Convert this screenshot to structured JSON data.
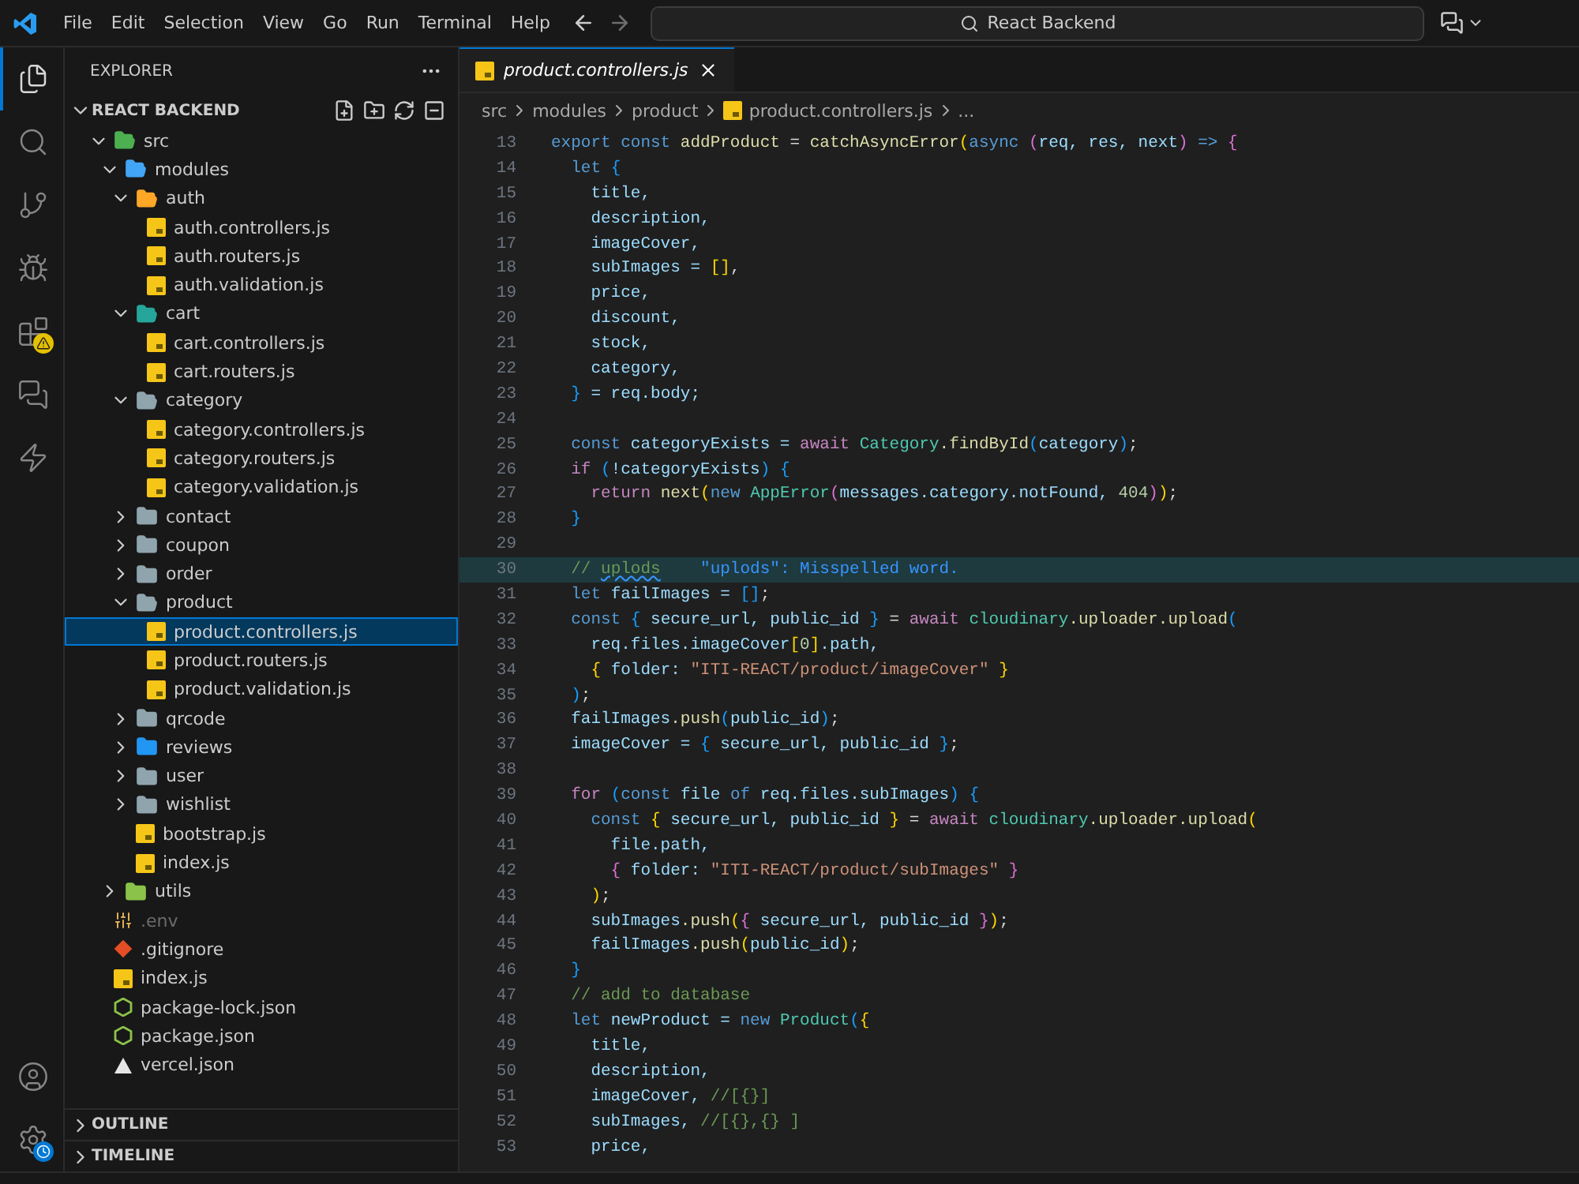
{
  "menu": [
    "File",
    "Edit",
    "Selection",
    "View",
    "Go",
    "Run",
    "Terminal",
    "Help"
  ],
  "search": {
    "text": "React Backend"
  },
  "activity_bar": {
    "items": [
      {
        "kind": "explorer",
        "selected": true
      },
      {
        "kind": "search",
        "selected": false
      },
      {
        "kind": "source-control",
        "selected": false
      },
      {
        "kind": "run",
        "selected": false
      },
      {
        "kind": "extensions",
        "selected": false,
        "warning": true
      },
      {
        "kind": "chat",
        "selected": false
      },
      {
        "kind": "bolt",
        "selected": false
      }
    ]
  },
  "sidebar": {
    "title": "EXPLORER",
    "root": "REACT BACKEND",
    "tree": [
      {
        "name": "src",
        "kind": "folder",
        "color": "#4caf50",
        "expanded": true,
        "selected": false,
        "dimmed": false,
        "children": [
          {
            "name": "modules",
            "kind": "folder",
            "color": "#42a5f5",
            "expanded": true,
            "selected": false,
            "dimmed": false,
            "children": [
              {
                "name": "auth",
                "kind": "folder",
                "color": "#ffa726",
                "expanded": true,
                "selected": false,
                "dimmed": false,
                "children": [
                  {
                    "name": "auth.controllers.js",
                    "kind": "js-file",
                    "selected": false,
                    "dimmed": false
                  },
                  {
                    "name": "auth.routers.js",
                    "kind": "js-file",
                    "selected": false,
                    "dimmed": false
                  },
                  {
                    "name": "auth.validation.js",
                    "kind": "js-file",
                    "selected": false,
                    "dimmed": false
                  }
                ]
              },
              {
                "name": "cart",
                "kind": "folder",
                "color": "#26a69a",
                "expanded": true,
                "selected": false,
                "dimmed": false,
                "children": [
                  {
                    "name": "cart.controllers.js",
                    "kind": "js-file",
                    "selected": false,
                    "dimmed": false
                  },
                  {
                    "name": "cart.routers.js",
                    "kind": "js-file",
                    "selected": false,
                    "dimmed": false
                  }
                ]
              },
              {
                "name": "category",
                "kind": "folder",
                "color": "#90a4ae",
                "expanded": true,
                "selected": false,
                "dimmed": false,
                "children": [
                  {
                    "name": "category.controllers.js",
                    "kind": "js-file",
                    "selected": false,
                    "dimmed": false
                  },
                  {
                    "name": "category.routers.js",
                    "kind": "js-file",
                    "selected": false,
                    "dimmed": false
                  },
                  {
                    "name": "category.validation.js",
                    "kind": "js-file",
                    "selected": false,
                    "dimmed": false
                  }
                ]
              },
              {
                "name": "contact",
                "kind": "folder",
                "color": "#90a4ae",
                "expanded": false,
                "selected": false,
                "dimmed": false
              },
              {
                "name": "coupon",
                "kind": "folder",
                "color": "#90a4ae",
                "expanded": false,
                "selected": false,
                "dimmed": false
              },
              {
                "name": "order",
                "kind": "folder",
                "color": "#90a4ae",
                "expanded": false,
                "selected": false,
                "dimmed": false
              },
              {
                "name": "product",
                "kind": "folder",
                "color": "#90a4ae",
                "expanded": true,
                "selected": false,
                "dimmed": false,
                "children": [
                  {
                    "name": "product.controllers.js",
                    "kind": "js-file",
                    "selected": true,
                    "dimmed": false
                  },
                  {
                    "name": "product.routers.js",
                    "kind": "js-file",
                    "selected": false,
                    "dimmed": false
                  },
                  {
                    "name": "product.validation.js",
                    "kind": "js-file",
                    "selected": false,
                    "dimmed": false
                  }
                ]
              },
              {
                "name": "qrcode",
                "kind": "folder",
                "color": "#90a4ae",
                "expanded": false,
                "selected": false,
                "dimmed": false
              },
              {
                "name": "reviews",
                "kind": "folder",
                "color": "#2196f3",
                "expanded": false,
                "selected": false,
                "dimmed": false
              },
              {
                "name": "user",
                "kind": "folder",
                "color": "#90a4ae",
                "expanded": false,
                "selected": false,
                "dimmed": false
              },
              {
                "name": "wishlist",
                "kind": "folder",
                "color": "#90a4ae",
                "expanded": false,
                "selected": false,
                "dimmed": false
              },
              {
                "name": "bootstrap.js",
                "kind": "js-file",
                "selected": false,
                "dimmed": false
              },
              {
                "name": "index.js",
                "kind": "js-file",
                "selected": false,
                "dimmed": false
              }
            ]
          },
          {
            "name": "utils",
            "kind": "folder",
            "color": "#8bc34a",
            "expanded": false,
            "selected": false,
            "dimmed": false
          }
        ]
      },
      {
        "name": ".env",
        "kind": "env-file",
        "selected": false,
        "dimmed": true
      },
      {
        "name": ".gitignore",
        "kind": "git-file",
        "selected": false,
        "dimmed": false
      },
      {
        "name": "index.js",
        "kind": "js-file",
        "selected": false,
        "dimmed": false
      },
      {
        "name": "package-lock.json",
        "kind": "node-file",
        "selected": false,
        "dimmed": false
      },
      {
        "name": "package.json",
        "kind": "node-file",
        "selected": false,
        "dimmed": false
      },
      {
        "name": "vercel.json",
        "kind": "vercel-file",
        "selected": false,
        "dimmed": false
      }
    ],
    "sections": [
      "OUTLINE",
      "TIMELINE"
    ]
  },
  "tabs": [
    {
      "label": "product.controllers.js",
      "selected": true
    }
  ],
  "breadcrumbs": [
    "src",
    "modules",
    "product",
    "product.controllers.js",
    "..."
  ],
  "code": [
    {
      "number": "13",
      "highlighted": false,
      "tokens": [
        {
          "kind": "keyword",
          "text": "export const "
        },
        {
          "kind": "function",
          "text": "addProduct"
        },
        {
          "kind": "plain",
          "text": " = "
        },
        {
          "kind": "function",
          "text": "catchAsyncError"
        },
        {
          "kind": "bracket1",
          "text": "("
        },
        {
          "kind": "keyword",
          "text": "async "
        },
        {
          "kind": "bracket2",
          "text": "("
        },
        {
          "kind": "variable",
          "text": "req, res, next"
        },
        {
          "kind": "bracket2",
          "text": ")"
        },
        {
          "kind": "keyword",
          "text": " => "
        },
        {
          "kind": "bracket2",
          "text": "{"
        }
      ]
    },
    {
      "number": "14",
      "highlighted": false,
      "tokens": [
        {
          "kind": "keyword",
          "text": "  let "
        },
        {
          "kind": "bracket3",
          "text": "{"
        }
      ]
    },
    {
      "number": "15",
      "highlighted": false,
      "tokens": [
        {
          "kind": "variable",
          "text": "    title,"
        }
      ]
    },
    {
      "number": "16",
      "highlighted": false,
      "tokens": [
        {
          "kind": "variable",
          "text": "    description,"
        }
      ]
    },
    {
      "number": "17",
      "highlighted": false,
      "tokens": [
        {
          "kind": "variable",
          "text": "    imageCover,"
        }
      ]
    },
    {
      "number": "18",
      "highlighted": false,
      "tokens": [
        {
          "kind": "variable",
          "text": "    subImages = "
        },
        {
          "kind": "bracket1",
          "text": "[]"
        },
        {
          "kind": "plain",
          "text": ","
        }
      ]
    },
    {
      "number": "19",
      "highlighted": false,
      "tokens": [
        {
          "kind": "variable",
          "text": "    price,"
        }
      ]
    },
    {
      "number": "20",
      "highlighted": false,
      "tokens": [
        {
          "kind": "variable",
          "text": "    discount,"
        }
      ]
    },
    {
      "number": "21",
      "highlighted": false,
      "tokens": [
        {
          "kind": "variable",
          "text": "    stock,"
        }
      ]
    },
    {
      "number": "22",
      "highlighted": false,
      "tokens": [
        {
          "kind": "variable",
          "text": "    category,"
        }
      ]
    },
    {
      "number": "23",
      "highlighted": false,
      "tokens": [
        {
          "kind": "bracket3",
          "text": "  }"
        },
        {
          "kind": "variable",
          "text": " = req.body;"
        }
      ]
    },
    {
      "number": "24",
      "highlighted": false
    },
    {
      "number": "25",
      "highlighted": false,
      "tokens": [
        {
          "kind": "keyword",
          "text": "  const "
        },
        {
          "kind": "variable",
          "text": "categoryExists = "
        },
        {
          "kind": "control",
          "text": "await "
        },
        {
          "kind": "type",
          "text": "Category"
        },
        {
          "kind": "function",
          "text": ".findById"
        },
        {
          "kind": "bracket3",
          "text": "("
        },
        {
          "kind": "variable",
          "text": "category"
        },
        {
          "kind": "bracket3",
          "text": ")"
        },
        {
          "kind": "plain",
          "text": ";"
        }
      ]
    },
    {
      "number": "26",
      "highlighted": false,
      "tokens": [
        {
          "kind": "control",
          "text": "  if "
        },
        {
          "kind": "bracket3",
          "text": "("
        },
        {
          "kind": "variable",
          "text": "!categoryExists"
        },
        {
          "kind": "bracket3",
          "text": ") {"
        }
      ]
    },
    {
      "number": "27",
      "highlighted": false,
      "tokens": [
        {
          "kind": "control",
          "text": "    return "
        },
        {
          "kind": "function",
          "text": "next"
        },
        {
          "kind": "bracket1",
          "text": "("
        },
        {
          "kind": "keyword",
          "text": "new "
        },
        {
          "kind": "type",
          "text": "AppError"
        },
        {
          "kind": "bracket2",
          "text": "("
        },
        {
          "kind": "variable",
          "text": "messages.category.notFound, "
        },
        {
          "kind": "number",
          "text": "404"
        },
        {
          "kind": "bracket2",
          "text": ")"
        },
        {
          "kind": "bracket1",
          "text": ")"
        },
        {
          "kind": "plain",
          "text": ";"
        }
      ]
    },
    {
      "number": "28",
      "highlighted": false,
      "tokens": [
        {
          "kind": "bracket3",
          "text": "  }"
        }
      ]
    },
    {
      "number": "29",
      "highlighted": false
    },
    {
      "number": "30",
      "highlighted": true,
      "tokens": [
        {
          "kind": "comment",
          "text": "  // "
        },
        {
          "kind": "misspelled",
          "text": "uplods"
        },
        {
          "kind": "hint",
          "text": "    \"uplods\": Misspelled word."
        }
      ]
    },
    {
      "number": "31",
      "highlighted": false,
      "tokens": [
        {
          "kind": "keyword",
          "text": "  let "
        },
        {
          "kind": "variable",
          "text": "failImages = "
        },
        {
          "kind": "bracket3",
          "text": "[]"
        },
        {
          "kind": "plain",
          "text": ";"
        }
      ]
    },
    {
      "number": "32",
      "highlighted": false,
      "tokens": [
        {
          "kind": "keyword",
          "text": "  const "
        },
        {
          "kind": "bracket3",
          "text": "{ "
        },
        {
          "kind": "variable",
          "text": "secure_url, public_id"
        },
        {
          "kind": "bracket3",
          "text": " }"
        },
        {
          "kind": "plain",
          "text": " = "
        },
        {
          "kind": "control",
          "text": "await "
        },
        {
          "kind": "type",
          "text": "cloudinary"
        },
        {
          "kind": "function",
          "text": ".uploader.upload"
        },
        {
          "kind": "bracket3",
          "text": "("
        }
      ]
    },
    {
      "number": "33",
      "highlighted": false,
      "tokens": [
        {
          "kind": "variable",
          "text": "    req.files.imageCover"
        },
        {
          "kind": "bracket1",
          "text": "["
        },
        {
          "kind": "number",
          "text": "0"
        },
        {
          "kind": "bracket1",
          "text": "]"
        },
        {
          "kind": "variable",
          "text": ".path,"
        }
      ]
    },
    {
      "number": "34",
      "highlighted": false,
      "tokens": [
        {
          "kind": "bracket1",
          "text": "    { "
        },
        {
          "kind": "variable",
          "text": "folder: "
        },
        {
          "kind": "string",
          "text": "\"ITI-REACT/product/imageCover\""
        },
        {
          "kind": "bracket1",
          "text": " }"
        }
      ]
    },
    {
      "number": "35",
      "highlighted": false,
      "tokens": [
        {
          "kind": "bracket3",
          "text": "  )"
        },
        {
          "kind": "plain",
          "text": ";"
        }
      ]
    },
    {
      "number": "36",
      "highlighted": false,
      "tokens": [
        {
          "kind": "variable",
          "text": "  failImages"
        },
        {
          "kind": "function",
          "text": ".push"
        },
        {
          "kind": "bracket3",
          "text": "("
        },
        {
          "kind": "variable",
          "text": "public_id"
        },
        {
          "kind": "bracket3",
          "text": ")"
        },
        {
          "kind": "plain",
          "text": ";"
        }
      ]
    },
    {
      "number": "37",
      "highlighted": false,
      "tokens": [
        {
          "kind": "variable",
          "text": "  imageCover = "
        },
        {
          "kind": "bracket3",
          "text": "{ "
        },
        {
          "kind": "variable",
          "text": "secure_url, public_id"
        },
        {
          "kind": "bracket3",
          "text": " }"
        },
        {
          "kind": "plain",
          "text": ";"
        }
      ]
    },
    {
      "number": "38",
      "highlighted": false
    },
    {
      "number": "39",
      "highlighted": false,
      "tokens": [
        {
          "kind": "control",
          "text": "  for "
        },
        {
          "kind": "bracket3",
          "text": "("
        },
        {
          "kind": "keyword",
          "text": "const "
        },
        {
          "kind": "variable",
          "text": "file"
        },
        {
          "kind": "keyword",
          "text": " of "
        },
        {
          "kind": "variable",
          "text": "req.files.subImages"
        },
        {
          "kind": "bracket3",
          "text": ") {"
        }
      ]
    },
    {
      "number": "40",
      "highlighted": false,
      "tokens": [
        {
          "kind": "keyword",
          "text": "    const "
        },
        {
          "kind": "bracket1",
          "text": "{ "
        },
        {
          "kind": "variable",
          "text": "secure_url, public_id"
        },
        {
          "kind": "bracket1",
          "text": " }"
        },
        {
          "kind": "plain",
          "text": " = "
        },
        {
          "kind": "control",
          "text": "await "
        },
        {
          "kind": "type",
          "text": "cloudinary"
        },
        {
          "kind": "function",
          "text": ".uploader.upload"
        },
        {
          "kind": "bracket1",
          "text": "("
        }
      ]
    },
    {
      "number": "41",
      "highlighted": false,
      "tokens": [
        {
          "kind": "variable",
          "text": "      file.path,"
        }
      ]
    },
    {
      "number": "42",
      "highlighted": false,
      "tokens": [
        {
          "kind": "bracket2",
          "text": "      { "
        },
        {
          "kind": "variable",
          "text": "folder: "
        },
        {
          "kind": "string",
          "text": "\"ITI-REACT/product/subImages\""
        },
        {
          "kind": "bracket2",
          "text": " }"
        }
      ]
    },
    {
      "number": "43",
      "highlighted": false,
      "tokens": [
        {
          "kind": "bracket1",
          "text": "    )"
        },
        {
          "kind": "plain",
          "text": ";"
        }
      ]
    },
    {
      "number": "44",
      "highlighted": false,
      "tokens": [
        {
          "kind": "variable",
          "text": "    subImages"
        },
        {
          "kind": "function",
          "text": ".push"
        },
        {
          "kind": "bracket1",
          "text": "("
        },
        {
          "kind": "bracket2",
          "text": "{ "
        },
        {
          "kind": "variable",
          "text": "secure_url, public_id"
        },
        {
          "kind": "bracket2",
          "text": " }"
        },
        {
          "kind": "bracket1",
          "text": ")"
        },
        {
          "kind": "plain",
          "text": ";"
        }
      ]
    },
    {
      "number": "45",
      "highlighted": false,
      "tokens": [
        {
          "kind": "variable",
          "text": "    failImages"
        },
        {
          "kind": "function",
          "text": ".push"
        },
        {
          "kind": "bracket1",
          "text": "("
        },
        {
          "kind": "variable",
          "text": "public_id"
        },
        {
          "kind": "bracket1",
          "text": ")"
        },
        {
          "kind": "plain",
          "text": ";"
        }
      ]
    },
    {
      "number": "46",
      "highlighted": false,
      "tokens": [
        {
          "kind": "bracket3",
          "text": "  }"
        }
      ]
    },
    {
      "number": "47",
      "highlighted": false,
      "tokens": [
        {
          "kind": "comment",
          "text": "  // add to database"
        }
      ]
    },
    {
      "number": "48",
      "highlighted": false,
      "tokens": [
        {
          "kind": "keyword",
          "text": "  let "
        },
        {
          "kind": "variable",
          "text": "newProduct = "
        },
        {
          "kind": "keyword",
          "text": "new "
        },
        {
          "kind": "type",
          "text": "Product"
        },
        {
          "kind": "bracket3",
          "text": "("
        },
        {
          "kind": "bracket1",
          "text": "{"
        }
      ]
    },
    {
      "number": "49",
      "highlighted": false,
      "tokens": [
        {
          "kind": "variable",
          "text": "    title,"
        }
      ]
    },
    {
      "number": "50",
      "highlighted": false,
      "tokens": [
        {
          "kind": "variable",
          "text": "    description,"
        }
      ]
    },
    {
      "number": "51",
      "highlighted": false,
      "tokens": [
        {
          "kind": "variable",
          "text": "    imageCover, "
        },
        {
          "kind": "comment",
          "text": "//[{}]"
        }
      ]
    },
    {
      "number": "52",
      "highlighted": false,
      "tokens": [
        {
          "kind": "variable",
          "text": "    subImages, "
        },
        {
          "kind": "comment",
          "text": "//[{},{} ]"
        }
      ]
    },
    {
      "number": "53",
      "highlighted": false,
      "tokens": [
        {
          "kind": "variable",
          "text": "    price,"
        }
      ]
    }
  ]
}
